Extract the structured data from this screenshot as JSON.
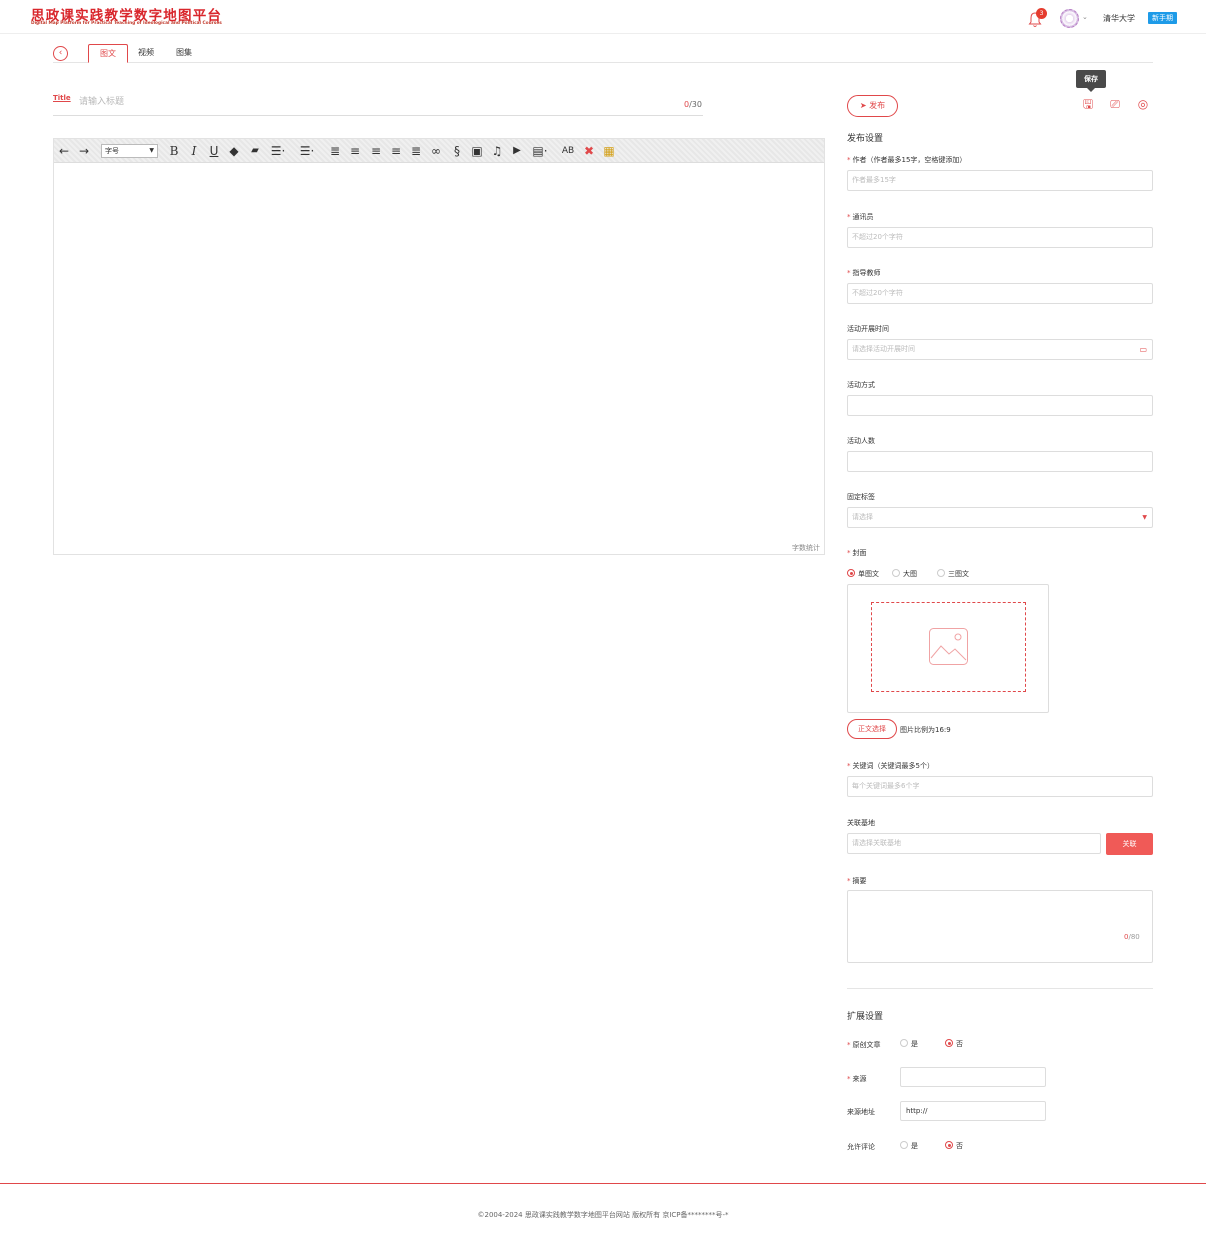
{
  "header": {
    "logo_cn": "思政课实践教学数字地图平台",
    "logo_en": "Digital Map Platform for Practical Teaching of Ideological and Political Courses",
    "notification_count": "3",
    "school": "清华大学",
    "newbie_label": "新手期"
  },
  "tabs": [
    {
      "label": "图文",
      "active": true
    },
    {
      "label": "视频",
      "active": false
    },
    {
      "label": "图集",
      "active": false
    }
  ],
  "title_field": {
    "icon_label": "Title",
    "placeholder": "请输入标题",
    "count_current": "0",
    "count_max": "/30"
  },
  "editor": {
    "font_size_label": "字号",
    "word_count_label": "字数统计",
    "toolbar_icons": [
      "undo-icon",
      "redo-icon",
      "bold-icon",
      "italic-icon",
      "underline-icon",
      "eraser-icon",
      "format-brush-icon",
      "ordered-list-icon",
      "unordered-list-icon",
      "indent-icon",
      "align-left-icon",
      "align-right-icon",
      "align-center-icon",
      "justify-icon",
      "link-icon",
      "unlink-icon",
      "image-icon",
      "music-icon",
      "video-icon",
      "template-icon",
      "spellcheck-icon",
      "clear-format-icon",
      "table-icon"
    ]
  },
  "actions": {
    "publish_label": "发布",
    "save_tooltip": "保存"
  },
  "publish_settings": {
    "section_title": "发布设置",
    "author_label": "作者（作者最多15字，空格键添加）",
    "author_placeholder": "作者最多15字",
    "correspondent_label": "通讯员",
    "correspondent_placeholder": "不超过20个字符",
    "advisor_label": "指导教师",
    "advisor_placeholder": "不超过20个字符",
    "activity_time_label": "活动开展时间",
    "activity_time_placeholder": "请选择活动开展时间",
    "activity_mode_label": "活动方式",
    "activity_count_label": "活动人数",
    "fixed_tag_label": "固定标签",
    "fixed_tag_placeholder": "请选择",
    "cover_label": "封面",
    "cover_options": [
      "单图文",
      "大图",
      "三图文"
    ],
    "cover_selected": "单图文",
    "select_from_body_label": "正文选择",
    "ratio_hint": "图片比例为16:9",
    "keywords_label": "关键词（关键词最多5个）",
    "keywords_placeholder": "每个关键词最多6个字",
    "linked_base_label": "关联基地",
    "linked_base_placeholder": "请选择关联基地",
    "link_button_label": "关联",
    "summary_label": "摘要",
    "summary_count_current": "0",
    "summary_count_max": "/80"
  },
  "extended_settings": {
    "section_title": "扩展设置",
    "original_label": "原创文章",
    "original_options": [
      "是",
      "否"
    ],
    "original_selected": "否",
    "source_label": "来源",
    "source_url_label": "来源地址",
    "source_url_value": "http://",
    "allow_comment_label": "允许评论",
    "allow_comment_options": [
      "是",
      "否"
    ],
    "allow_comment_selected": "否"
  },
  "footer": {
    "text": "©2004-2024 思政课实践教学数字地图平台网站 版权所有 京ICP备********号-*"
  },
  "colors": {
    "accent": "#e0484a",
    "newbie_badge": "#1e9be8",
    "link_button": "#f05a57"
  }
}
